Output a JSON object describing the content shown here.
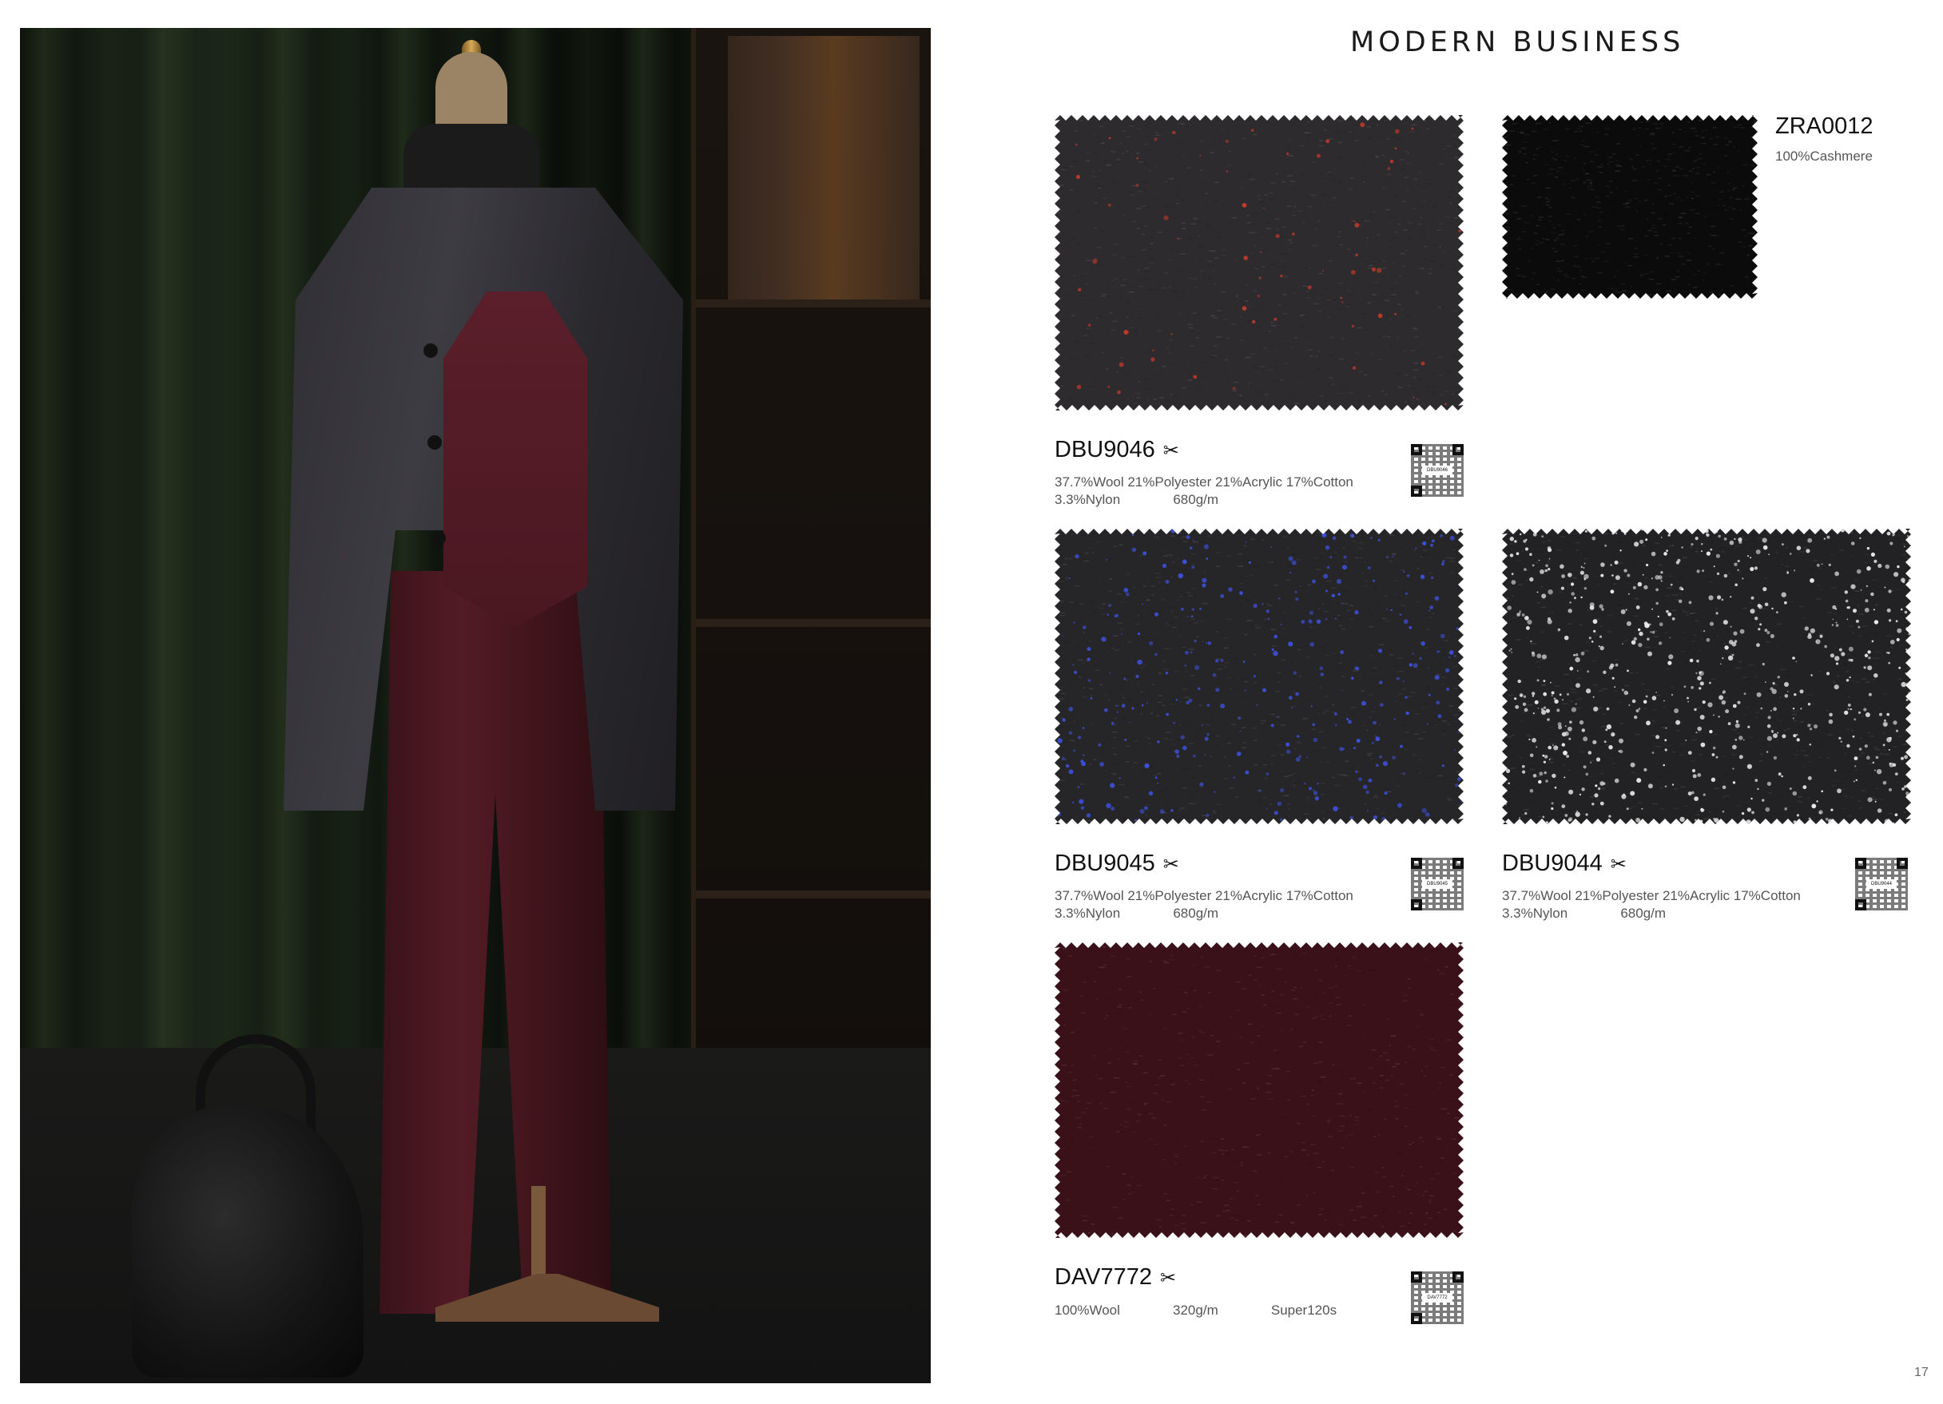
{
  "page": {
    "title": "MODERN BUSINESS",
    "page_number": "17"
  },
  "photo": {
    "description_icon": "mannequin-suit-photo"
  },
  "swatches": [
    {
      "code": "DBU9046",
      "composition_line1": "37.7%Wool 21%Polyester 21%Acrylic 17%Cotton",
      "composition_line2": "3.3%Nylon              680g/m",
      "qr_label": "DBU9046",
      "base_color": "#2d2b2d",
      "fleck_color": "#c0392b"
    },
    {
      "code": "ZRA0012",
      "composition_line1": "100%Cashmere",
      "composition_line2": "",
      "qr_label": "",
      "base_color": "#0b0b0b",
      "fleck_color": "#1a1a1a"
    },
    {
      "code": "DBU9045",
      "composition_line1": "37.7%Wool 21%Polyester 21%Acrylic 17%Cotton",
      "composition_line2": "3.3%Nylon              680g/m",
      "qr_label": "DBU9045",
      "base_color": "#262629",
      "fleck_color": "#3c4fd6"
    },
    {
      "code": "DBU9044",
      "composition_line1": "37.7%Wool 21%Polyester 21%Acrylic 17%Cotton",
      "composition_line2": "3.3%Nylon              680g/m",
      "qr_label": "DBU9044",
      "base_color": "#222224",
      "fleck_color": "#e8e8e8"
    },
    {
      "code": "DAV7772",
      "composition_line1": "100%Wool              320g/m              Super120s",
      "composition_line2": "",
      "qr_label": "DAV7772",
      "base_color": "#3a1119",
      "fleck_color": "#4a1620"
    }
  ],
  "icons": {
    "scissors": "scissors-icon",
    "qr": "qr-code-icon"
  }
}
